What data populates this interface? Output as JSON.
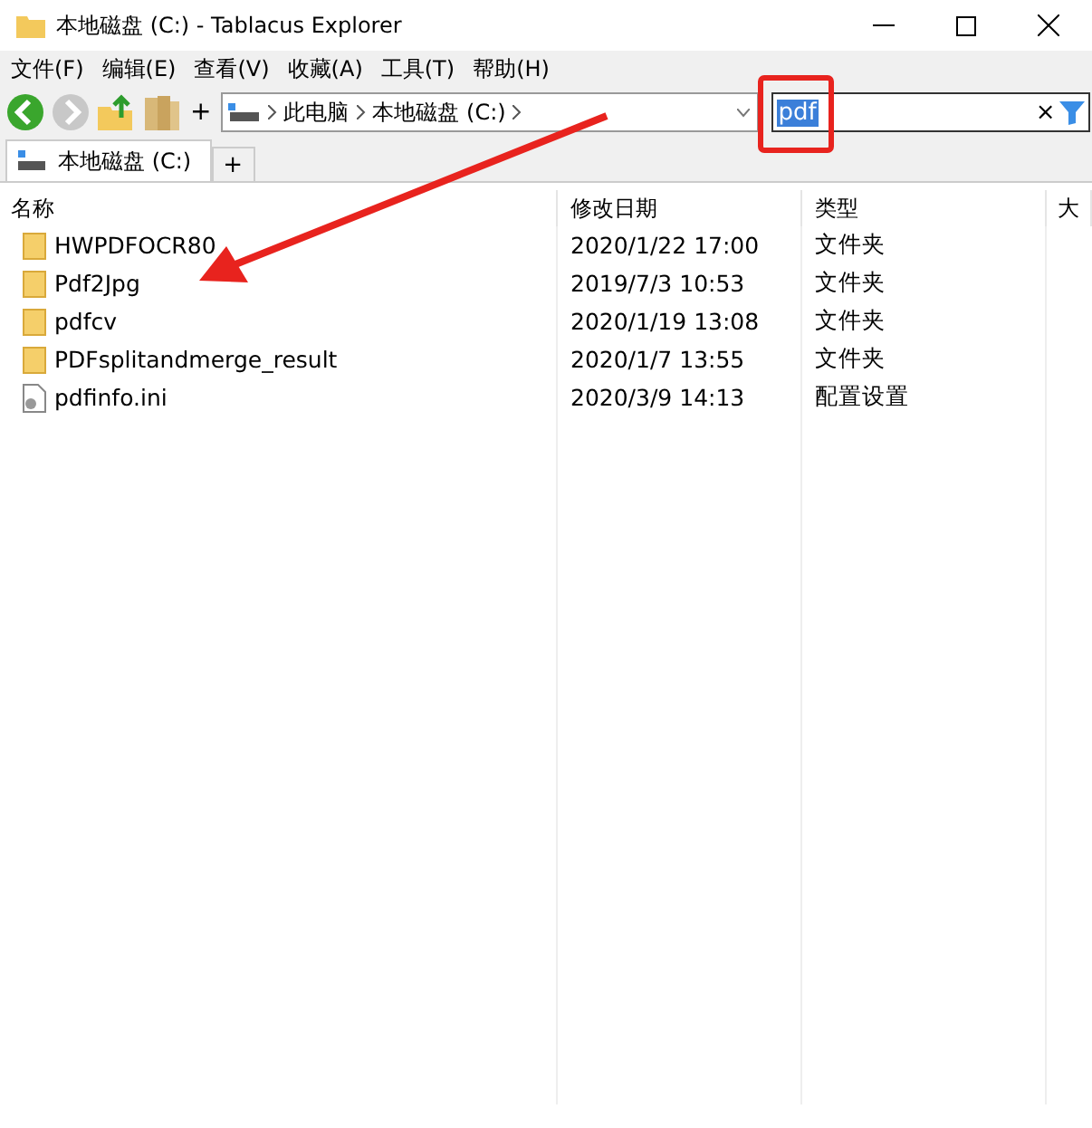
{
  "window": {
    "title": "本地磁盘 (C:) - Tablacus Explorer"
  },
  "menu": [
    "文件(F)",
    "编辑(E)",
    "查看(V)",
    "收藏(A)",
    "工具(T)",
    "帮助(H)"
  ],
  "toolbar": {
    "add_label": "+",
    "breadcrumb": [
      "此电脑",
      "本地磁盘 (C:)"
    ]
  },
  "search": {
    "value": "pdf",
    "highlighted": true,
    "clear_label": "×"
  },
  "tabs": [
    {
      "label": "本地磁盘 (C:)",
      "selected": true
    }
  ],
  "new_tab_label": "+",
  "table": {
    "columns": [
      "名称",
      "修改日期",
      "类型",
      "大"
    ],
    "rows": [
      {
        "kind": "folder",
        "name": "HWPDFOCR80",
        "date": "2020/1/22 17:00",
        "type": "文件夹"
      },
      {
        "kind": "folder",
        "name": "Pdf2Jpg",
        "date": "2019/7/3 10:53",
        "type": "文件夹"
      },
      {
        "kind": "folder",
        "name": "pdfcv",
        "date": "2020/1/19 13:08",
        "type": "文件夹"
      },
      {
        "kind": "folder",
        "name": "PDFsplitandmerge_result",
        "date": "2020/1/7 13:55",
        "type": "文件夹"
      },
      {
        "kind": "file",
        "name": "pdfinfo.ini",
        "date": "2020/3/9 14:13",
        "type": "配置设置"
      }
    ]
  }
}
